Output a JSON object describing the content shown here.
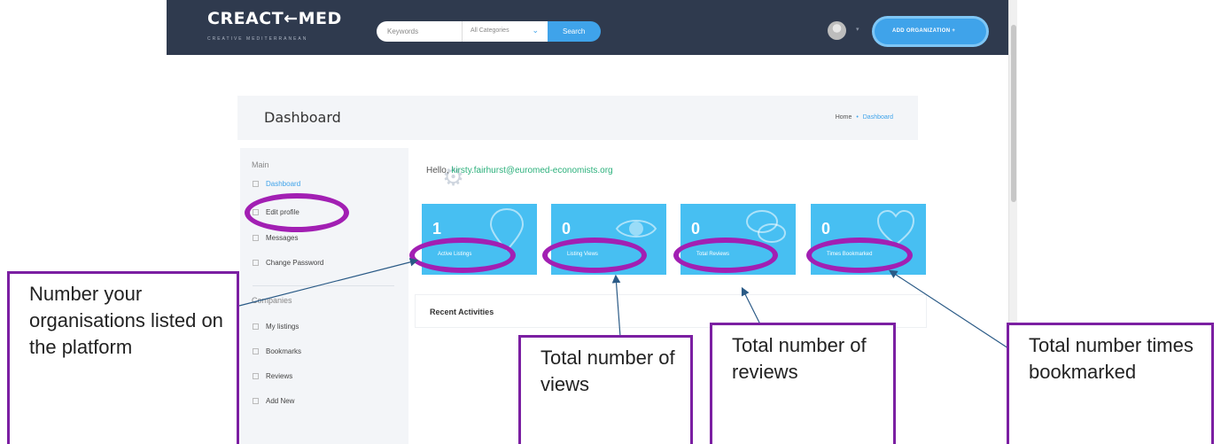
{
  "header": {
    "logo": "CREACT←MED",
    "logo_tagline": "CREATIVE MEDITERRANEAN",
    "search_placeholder": "Keywords",
    "category_select": "All Categories",
    "search_button": "Search",
    "add_org_button": "ADD ORGANIZATION +"
  },
  "page": {
    "title": "Dashboard",
    "breadcrumb_home": "Home",
    "breadcrumb_sep": "•",
    "breadcrumb_current": "Dashboard"
  },
  "sidebar": {
    "main_label": "Main",
    "main_items": [
      {
        "label": "Dashboard",
        "icon": "dashboard-icon"
      },
      {
        "label": "Edit profile",
        "icon": "profile-icon"
      },
      {
        "label": "Messages",
        "icon": "message-icon"
      },
      {
        "label": "Change Password",
        "icon": "lock-icon"
      }
    ],
    "companies_label": "Companies",
    "companies_items": [
      {
        "label": "My listings",
        "icon": "list-icon"
      },
      {
        "label": "Bookmarks",
        "icon": "bookmark-icon"
      },
      {
        "label": "Reviews",
        "icon": "star-icon"
      },
      {
        "label": "Add New",
        "icon": "plus-icon"
      }
    ]
  },
  "greeting": {
    "prefix": "Hello, ",
    "email": "kirsty.fairhurst@euromed-economists.org"
  },
  "stats": [
    {
      "value": "1",
      "label": "Active Listings",
      "icon": "map-pin-icon"
    },
    {
      "value": "0",
      "label": "Listing Views",
      "icon": "eye-icon"
    },
    {
      "value": "0",
      "label": "Total Reviews",
      "icon": "chat-icon"
    },
    {
      "value": "0",
      "label": "Times Bookmarked",
      "icon": "heart-icon"
    }
  ],
  "recent_activities_title": "Recent Activities",
  "annotations": {
    "listings_note": "Number your organisations listed on the platform",
    "views_note": "Total number of views",
    "reviews_note": "Total number of reviews",
    "bookmarks_note": "Total number times bookmarked"
  },
  "colors": {
    "navbar": "#2f3a4e",
    "accent_blue": "#3fa3ea",
    "card_blue": "#47bff2",
    "annotation_purple": "#a21fb3",
    "arrow": "#2a5a86"
  }
}
